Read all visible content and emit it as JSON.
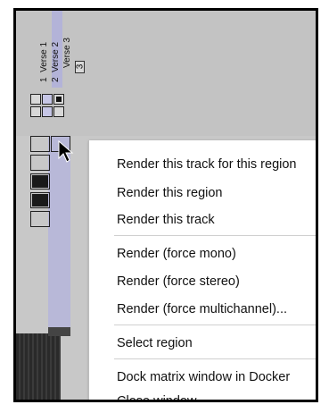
{
  "regions": [
    {
      "number": "1",
      "name": "Verse 1",
      "selected": false
    },
    {
      "number": "2",
      "name": "Verse 2",
      "selected": true
    },
    {
      "number": "3",
      "name": "Verse 3",
      "selected": false
    }
  ],
  "context_menu": {
    "items": [
      "Render this track for this region",
      "Render this region",
      "Render this track",
      "Render (force mono)",
      "Render (force stereo)",
      "Render (force multichannel)...",
      "Select region",
      "Dock matrix window in Docker",
      "Close window"
    ]
  },
  "colors": {
    "selected_column": "#b8b8d8",
    "panel_bg": "#c8c8c8",
    "menu_bg": "#ffffff"
  }
}
